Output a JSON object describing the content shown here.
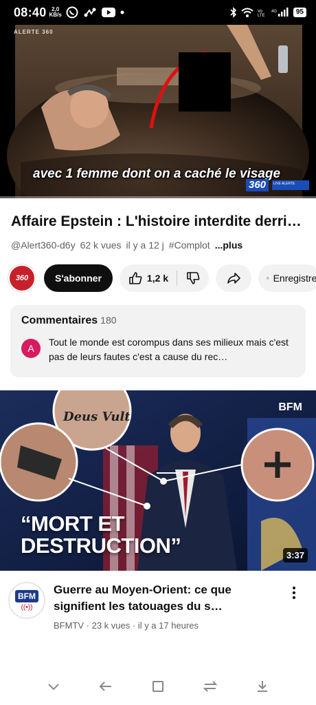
{
  "status_bar": {
    "time": "08:40",
    "net_speed_value": "2,0",
    "net_speed_unit": "KB/s",
    "battery": "95",
    "icons": [
      "whatsapp-icon",
      "route-icon",
      "youtube-icon",
      "dot-icon",
      "bluetooth-icon",
      "wifi-icon",
      "volte-icon",
      "signal-icon",
      "battery-icon"
    ]
  },
  "player": {
    "channel_watermark": "ALERTE 360",
    "caption": "avec 1 femme dont on a caché le visage",
    "logo": "360",
    "logo_strip": "LIVE ALERTE",
    "progress": 0.0
  },
  "video": {
    "title": "Affaire Epstein : L'histoire interdite derrière…",
    "channel_handle": "@Alert360-d6y",
    "views": "62 k vues",
    "age": "il y a 12 j",
    "hashtag": "#Complot",
    "more": "...plus"
  },
  "actions": {
    "avatar_text": "360",
    "subscribe": "S'abonner",
    "likes": "1,2 k",
    "save": "Enregistrer"
  },
  "comments": {
    "header": "Commentaires",
    "count": "180",
    "first_avatar": "A",
    "first_text": "Tout le monde est corompus dans ses milieux mais c'est pas de leurs fautes c'est a cause du rec…"
  },
  "next_video": {
    "thumb_watermark": "BFM",
    "tattoo_text": "Deus Vult",
    "headline_line1": "“MORT ET",
    "headline_line2": "DESTRUCTION”",
    "duration": "3:37",
    "channel_avatar": "BFM",
    "channel_avatar_live": "((•))",
    "title": "Guerre au Moyen-Orient: ce que signifient les tatouages du s…",
    "meta": "BFMTV · 23 k vues · il y a 17 heures"
  },
  "colors": {
    "accent_red": "#ff0000",
    "bfm_blue": "#1d3a8a",
    "comment_avatar": "#d81b60"
  }
}
